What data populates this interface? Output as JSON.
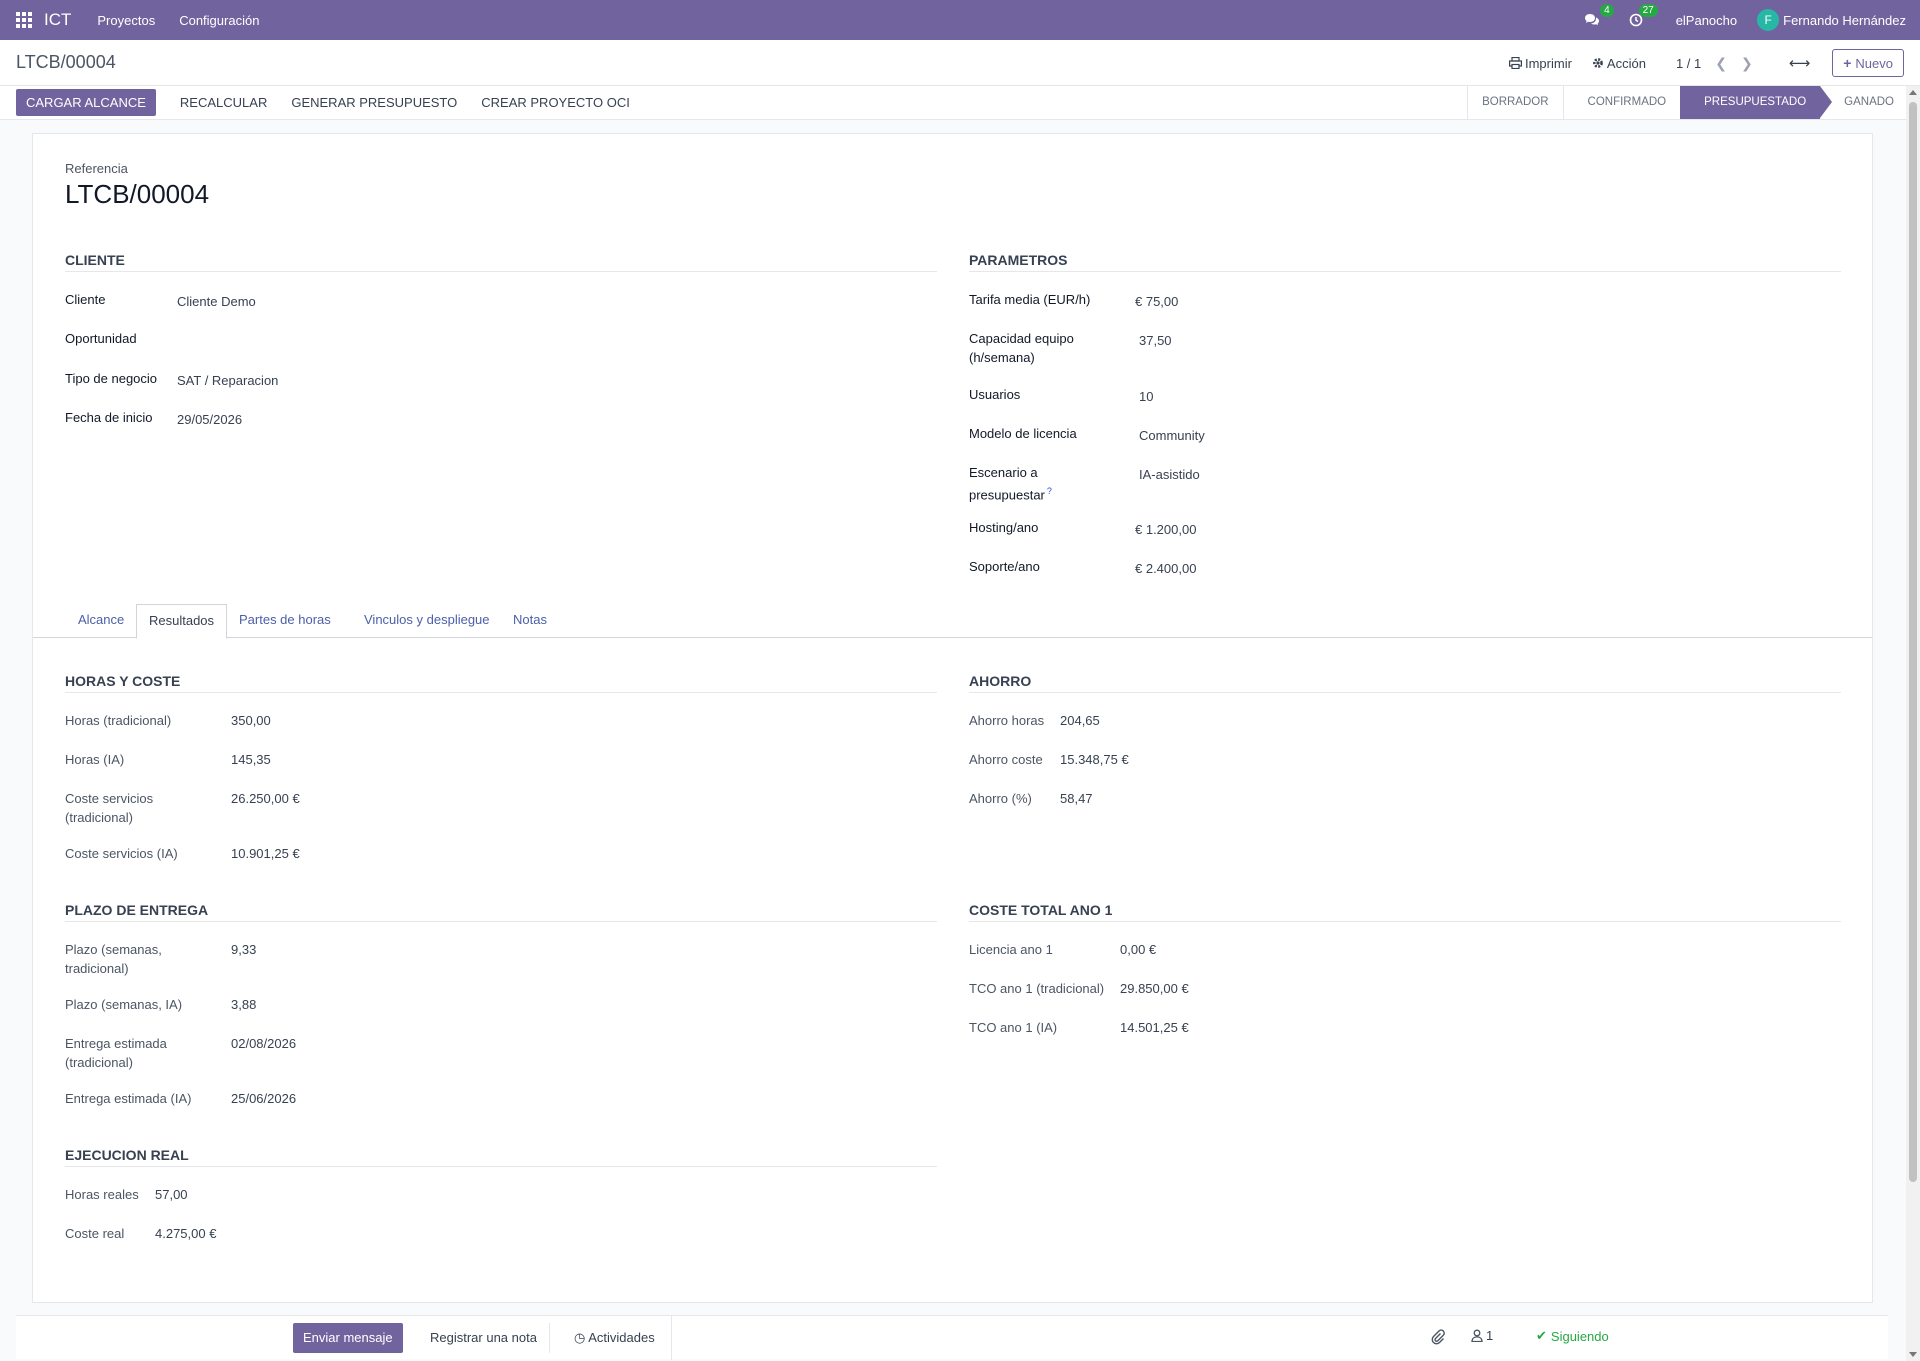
{
  "navbar": {
    "app": "ICT",
    "menus": [
      "Proyectos",
      "Configuración"
    ],
    "messages_count": "4",
    "activities_count": "27",
    "company": "elPanocho",
    "user_initial": "F",
    "user_name": "Fernando Hernández"
  },
  "control": {
    "breadcrumb": "LTCB/00004",
    "print": "Imprimir",
    "action": "Acción",
    "pager": "1 / 1",
    "new": "Nuevo"
  },
  "statusbar": {
    "buttons": [
      "CARGAR ALCANCE",
      "RECALCULAR",
      "GENERAR PRESUPUESTO",
      "CREAR PROYECTO OCI"
    ],
    "stages": [
      "BORRADOR",
      "CONFIRMADO",
      "PRESUPUESTADO",
      "GANADO"
    ],
    "active_stage": "PRESUPUESTADO"
  },
  "form": {
    "ref_label": "Referencia",
    "ref_value": "LTCB/00004",
    "cliente": {
      "title": "CLIENTE",
      "fields": [
        {
          "label": "Cliente",
          "value": "Cliente Demo"
        },
        {
          "label": "Oportunidad",
          "value": ""
        },
        {
          "label": "Tipo de negocio",
          "value": "SAT / Reparacion"
        },
        {
          "label": "Fecha de inicio",
          "value": "29/05/2026"
        }
      ]
    },
    "parametros": {
      "title": "PARAMETROS",
      "fields": [
        {
          "label": "Tarifa media (EUR/h)",
          "value": "€ 75,00"
        },
        {
          "label": "Capacidad equipo (h/semana)",
          "label_1": "Capacidad equipo",
          "label_2": "(h/semana)",
          "value": "37,50"
        },
        {
          "label": "Usuarios",
          "value": "10"
        },
        {
          "label": "Modelo de licencia",
          "value": "Community"
        },
        {
          "label": "Escenario a presupuestar",
          "label_1": "Escenario a",
          "label_2": "presupuestar",
          "help": "?",
          "value": "IA-asistido"
        },
        {
          "label": "Hosting/ano",
          "value": "€ 1.200,00"
        },
        {
          "label": "Soporte/ano",
          "value": "€ 2.400,00"
        }
      ]
    }
  },
  "tabs": [
    "Alcance",
    "Resultados",
    "Partes de horas",
    "Vinculos y despliegue",
    "Notas"
  ],
  "active_tab": "Resultados",
  "results": {
    "horas": {
      "title": "HORAS Y COSTE",
      "rows": [
        {
          "label": "Horas (tradicional)",
          "value": "350,00"
        },
        {
          "label": "Horas (IA)",
          "value": "145,35"
        },
        {
          "label": "Coste servicios (tradicional)",
          "label_1": "Coste servicios",
          "label_2": "(tradicional)",
          "value": "26.250,00 €"
        },
        {
          "label": "Coste servicios (IA)",
          "value": "10.901,25 €"
        }
      ]
    },
    "ahorro": {
      "title": "AHORRO",
      "rows": [
        {
          "label": "Ahorro horas",
          "value": "204,65"
        },
        {
          "label": "Ahorro coste",
          "value": "15.348,75 €"
        },
        {
          "label": "Ahorro (%)",
          "value": "58,47"
        }
      ]
    },
    "plazo": {
      "title": "PLAZO DE ENTREGA",
      "rows": [
        {
          "label": "Plazo (semanas, tradicional)",
          "label_1": "Plazo (semanas,",
          "label_2": "tradicional)",
          "value": "9,33"
        },
        {
          "label": "Plazo (semanas, IA)",
          "value": "3,88"
        },
        {
          "label": "Entrega estimada (tradicional)",
          "label_1": "Entrega estimada",
          "label_2": "(tradicional)",
          "value": "02/08/2026"
        },
        {
          "label": "Entrega estimada (IA)",
          "value": "25/06/2026"
        }
      ]
    },
    "coste_total": {
      "title": "COSTE TOTAL ANO 1",
      "rows": [
        {
          "label": "Licencia ano 1",
          "value": "0,00 €"
        },
        {
          "label": "TCO ano 1 (tradicional)",
          "value": "29.850,00 €"
        },
        {
          "label": "TCO ano 1 (IA)",
          "value": "14.501,25 €"
        }
      ]
    },
    "ejecucion": {
      "title": "EJECUCION REAL",
      "rows": [
        {
          "label": "Horas reales",
          "value": "57,00"
        },
        {
          "label": "Coste real",
          "value": "4.275,00 €"
        }
      ]
    }
  },
  "chatter": {
    "send": "Enviar mensaje",
    "note": "Registrar una nota",
    "activities": "Actividades",
    "followers": "1",
    "following": "Siguiendo"
  },
  "colors": {
    "brand": "#71639e",
    "success": "#28a745"
  }
}
